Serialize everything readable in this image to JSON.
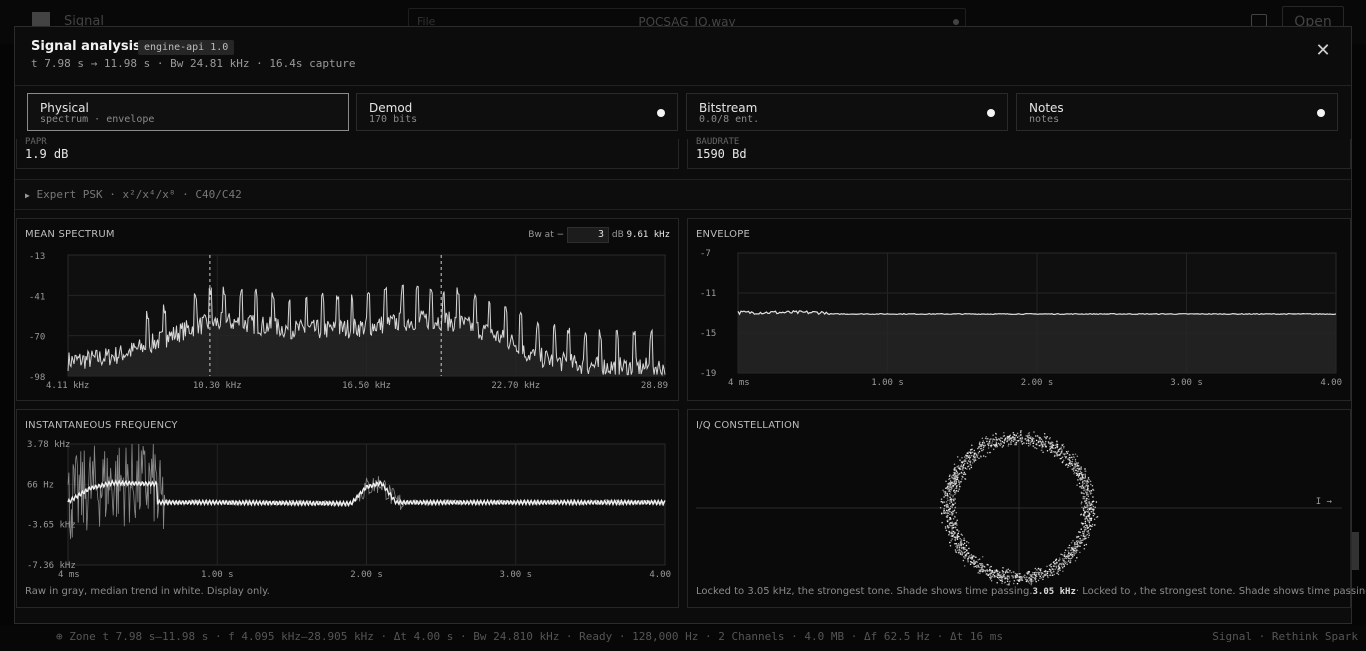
{
  "app": {
    "name": "Signal",
    "file_label": "File",
    "file_name": "POCSAG_IQ.wav",
    "open_label": "Open"
  },
  "modal": {
    "title": "Signal analysis",
    "badge": "engine-api 1.0",
    "subtitle": "t 7.98 s → 11.98 s · Bw 24.81 kHz · 16.4s capture",
    "close_glyph": "✕"
  },
  "tabs": [
    {
      "label": "Physical",
      "sub": "spectrum · envelope",
      "active": true
    },
    {
      "label": "Demod",
      "sub": "170 bits",
      "active": false
    },
    {
      "label": "Bitstream",
      "sub": "0.0/8 ent.",
      "active": false
    },
    {
      "label": "Notes",
      "sub": "notes",
      "active": false
    }
  ],
  "fields": [
    {
      "label": "PAPR",
      "value": "1.9 dB"
    },
    {
      "label": "BAUDRATE",
      "value": "1590 Bd"
    }
  ],
  "expert": {
    "arrow": "▶",
    "label": "Expert PSK · x²/x⁴/x⁸ · C40/C42"
  },
  "spectrum": {
    "title": "MEAN SPECTRUM",
    "bw_label": "Bw at −",
    "bw_input": "3",
    "bw_unit": "dB",
    "bw_value": "9.61 kHz",
    "chart_data": {
      "type": "line",
      "yticks": [
        "-13",
        "-41",
        "-70",
        "-98"
      ],
      "xticks": [
        "4.11 kHz",
        "10.30 kHz",
        "16.50 kHz",
        "22.70 kHz",
        "28.89"
      ],
      "xlim": [
        4.11,
        28.89
      ],
      "ylim": [
        -98,
        -13
      ],
      "markers_khz": [
        10.0,
        19.6
      ],
      "peaks_khz": [
        7.4,
        8.1,
        9.4,
        10.0,
        10.6,
        11.3,
        11.9,
        12.6,
        13.3,
        14.0,
        14.7,
        15.3,
        15.9,
        16.6,
        17.3,
        18.0,
        18.6,
        19.2,
        19.7,
        20.3,
        21.0,
        21.6,
        22.3,
        22.9,
        23.6,
        24.3,
        24.9,
        25.6,
        26.2,
        26.9,
        27.6,
        28.3
      ]
    }
  },
  "envelope": {
    "title": "ENVELOPE",
    "chart_data": {
      "type": "line",
      "yticks": [
        "-7",
        "-11",
        "-15",
        "-19"
      ],
      "xticks": [
        "4 ms",
        "1.00 s",
        "2.00 s",
        "3.00 s",
        "4.00"
      ],
      "ylim": [
        -19,
        -7
      ],
      "xlim": [
        0.004,
        4.0
      ],
      "level": -13.1
    }
  },
  "instfreq": {
    "title": "INSTANTANEOUS FREQUENCY",
    "note": "Raw in gray, median trend in white. Display only.",
    "chart_data": {
      "type": "line",
      "yticks": [
        "3.78 kHz",
        "66 Hz",
        "-3.65 kHz",
        "-7.36 kHz"
      ],
      "xticks": [
        "4 ms",
        "1.00 s",
        "2.00 s",
        "3.00 s",
        "4.00"
      ],
      "ylim": [
        -7.36,
        3.78
      ],
      "xlim": [
        0.004,
        4.0
      ],
      "series": [
        {
          "x": [
            0.0,
            0.15,
            0.3,
            0.6,
            0.6,
            0.9,
            1.9,
            2.0,
            2.1,
            2.2,
            4.0
          ],
          "y": [
            -1.6,
            -0.3,
            0.2,
            0.1,
            -1.6,
            -1.6,
            -1.7,
            -0.2,
            0.2,
            -1.6,
            -1.6
          ]
        }
      ]
    }
  },
  "constellation": {
    "title": "I/Q CONSTELLATION",
    "axis_label": "I →",
    "note_a": "Locked to 3.05 kHz, the strongest tone. Shade shows time passing.",
    "note_b": "3.05 kHz",
    "note_c": "· Locked to , the strongest tone. Shade shows time passing.",
    "chart_data": {
      "type": "scatter",
      "radius": 0.88,
      "lim": [
        -1.4,
        1.4
      ]
    }
  },
  "status": {
    "left": "⊕ Zone t 7.98 s–11.98 s · f 4.095 kHz–28.905 kHz · Δt 4.00 s · Bw 24.810 kHz · Ready · 128,000 Hz · 2 Channels · 4.0 MB · Δf 62.5 Hz · Δt 16 ms",
    "right": "Signal · Rethink Spark"
  }
}
